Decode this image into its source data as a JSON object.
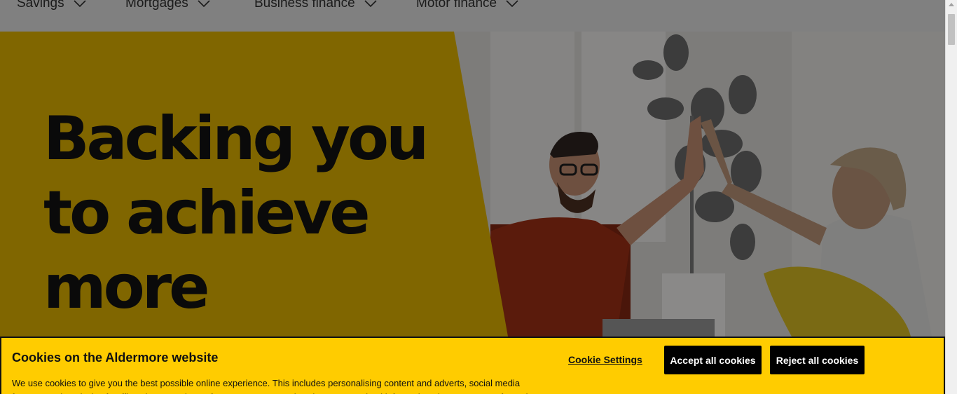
{
  "nav": {
    "items": [
      {
        "label": "Savings"
      },
      {
        "label": "Mortgages"
      },
      {
        "label": "Business finance"
      },
      {
        "label": "Motor finance"
      }
    ]
  },
  "hero": {
    "headline_lines": [
      "Backing you",
      "to achieve",
      "more"
    ],
    "accent_color": "#806600"
  },
  "cookie_banner": {
    "title": "Cookies on the Aldermore website",
    "text": "We use cookies to give you the best possible online experience. This includes personalising content and adverts, social media features and analysis of traffic to improve site performance. We may also share anonymised information about your use of our site",
    "settings_label": "Cookie Settings",
    "accept_label": "Accept all cookies",
    "reject_label": "Reject all cookies",
    "background_color": "#ffcc00"
  }
}
